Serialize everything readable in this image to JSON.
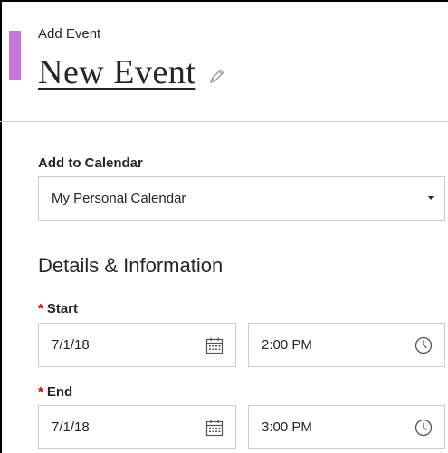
{
  "panel": {
    "label": "Add Event"
  },
  "event": {
    "title": "New Event"
  },
  "calendar": {
    "label": "Add to Calendar",
    "selected": "My Personal Calendar"
  },
  "details": {
    "heading": "Details & Information"
  },
  "start": {
    "required_mark": "*",
    "label": "Start",
    "date": "7/1/18",
    "time": "2:00 PM"
  },
  "end": {
    "required_mark": "*",
    "label": "End",
    "date": "7/1/18",
    "time": "3:00 PM"
  },
  "icons": {
    "edit": "pencil-icon",
    "calendar": "calendar-icon",
    "clock": "clock-icon",
    "dropdown": "chevron-down-icon"
  },
  "colors": {
    "accent": "#c777d6",
    "required": "#d10000",
    "border": "#cdcdcd"
  }
}
